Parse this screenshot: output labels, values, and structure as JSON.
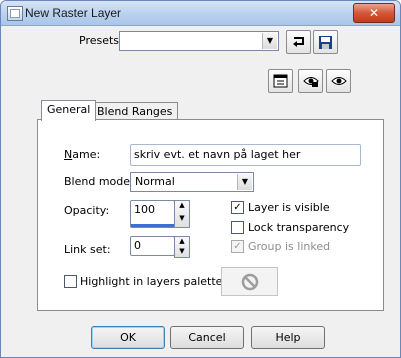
{
  "window": {
    "title": "New Raster Layer",
    "close_glyph": "✕"
  },
  "presets": {
    "label": "Presets:",
    "value": ""
  },
  "tabs": [
    {
      "label": "General"
    },
    {
      "label": "Blend Ranges"
    }
  ],
  "general": {
    "name_label": "Name:",
    "name_value": "skriv evt. et navn på laget her",
    "blend_mode_label": "Blend mode:",
    "blend_mode_value": "Normal",
    "opacity_label": "Opacity:",
    "opacity_value": "100",
    "link_set_label": "Link set:",
    "link_set_value": "0",
    "layer_visible_label": "Layer is visible",
    "layer_visible_checked": true,
    "lock_transparency_label": "Lock transparency",
    "lock_transparency_checked": false,
    "group_linked_label": "Group is linked",
    "group_linked_checked": true,
    "highlight_label": "Highlight in layers palette:",
    "highlight_checked": false,
    "opacity_level": 1.0
  },
  "buttons": {
    "ok": "OK",
    "cancel": "Cancel",
    "help": "Help"
  },
  "icons": [
    "window-icon",
    "reset-presets-icon",
    "save-preset-icon",
    "layer-properties-icon",
    "eye-lock-icon",
    "eye-icon",
    "no-color-icon"
  ]
}
